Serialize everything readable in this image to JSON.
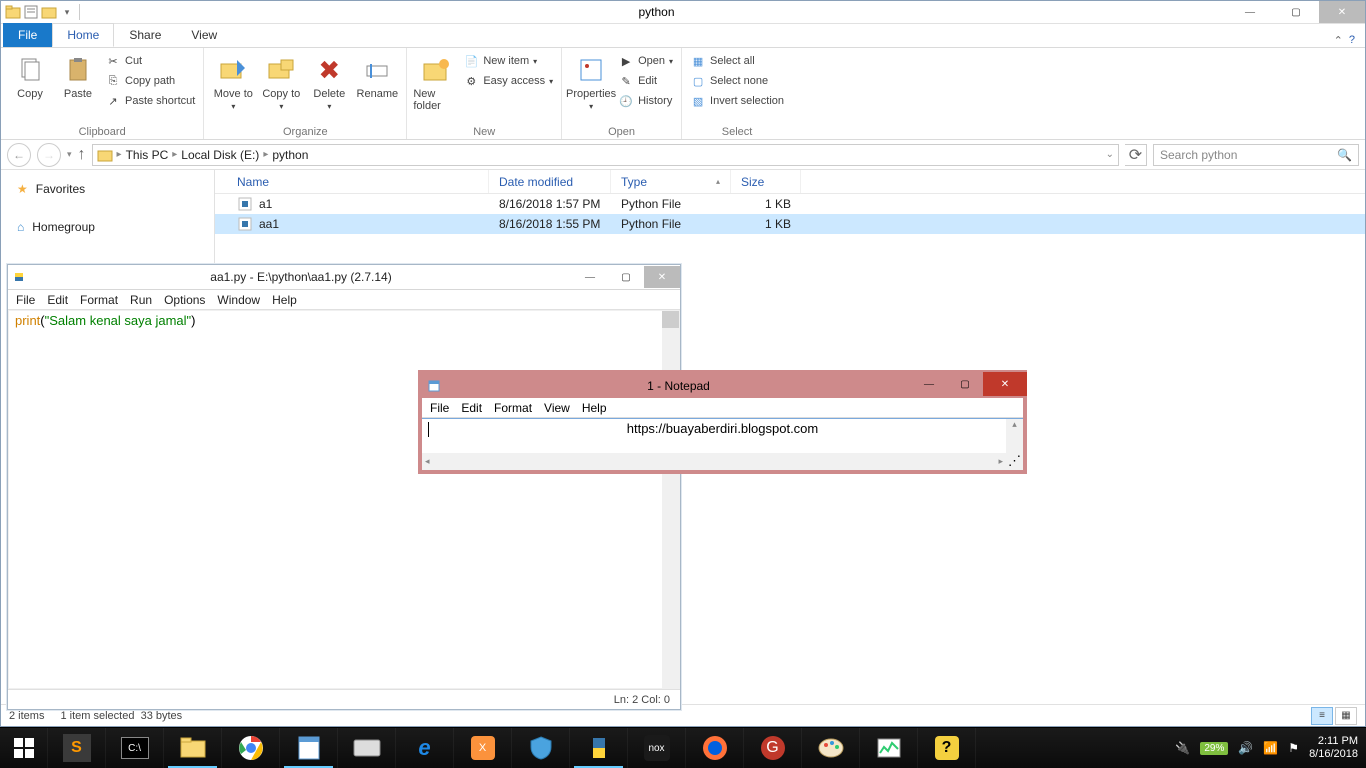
{
  "explorer": {
    "title": "python",
    "tabs": {
      "file": "File",
      "home": "Home",
      "share": "Share",
      "view": "View"
    },
    "ribbon": {
      "clipboard": {
        "label": "Clipboard",
        "copy": "Copy",
        "paste": "Paste",
        "cut": "Cut",
        "copy_path": "Copy path",
        "paste_shortcut": "Paste shortcut"
      },
      "organize": {
        "label": "Organize",
        "move": "Move to",
        "copy": "Copy to",
        "delete": "Delete",
        "rename": "Rename"
      },
      "new": {
        "label": "New",
        "new_folder": "New folder",
        "new_item": "New item",
        "easy_access": "Easy access"
      },
      "open": {
        "label": "Open",
        "properties": "Properties",
        "open": "Open",
        "edit": "Edit",
        "history": "History"
      },
      "select": {
        "label": "Select",
        "select_all": "Select all",
        "select_none": "Select none",
        "invert": "Invert selection"
      }
    },
    "breadcrumb": [
      "This PC",
      "Local Disk  (E:)",
      "python"
    ],
    "search_placeholder": "Search python",
    "sidebar": {
      "favorites": "Favorites",
      "homegroup": "Homegroup"
    },
    "columns": {
      "name": "Name",
      "date": "Date modified",
      "type": "Type",
      "size": "Size"
    },
    "files": [
      {
        "name": "a1",
        "date": "8/16/2018 1:57 PM",
        "type": "Python File",
        "size": "1 KB",
        "selected": false
      },
      {
        "name": "aa1",
        "date": "8/16/2018 1:55 PM",
        "type": "Python File",
        "size": "1 KB",
        "selected": true
      }
    ],
    "status": {
      "items": "2 items",
      "selected": "1 item selected",
      "bytes": "33 bytes"
    }
  },
  "idle": {
    "title": "aa1.py - E:\\python\\aa1.py (2.7.14)",
    "menu": [
      "File",
      "Edit",
      "Format",
      "Run",
      "Options",
      "Window",
      "Help"
    ],
    "code": {
      "kw": "print",
      "paren_open": "(",
      "str": "\"Salam kenal saya jamal\"",
      "paren_close": ")"
    },
    "status": "Ln: 2  Col: 0"
  },
  "notepad": {
    "title": "1 - Notepad",
    "menu": [
      "File",
      "Edit",
      "Format",
      "View",
      "Help"
    ],
    "content": "https://buayaberdiri.blogspot.com"
  },
  "tray": {
    "battery": "29%",
    "time": "2:11 PM",
    "date": "8/16/2018"
  }
}
